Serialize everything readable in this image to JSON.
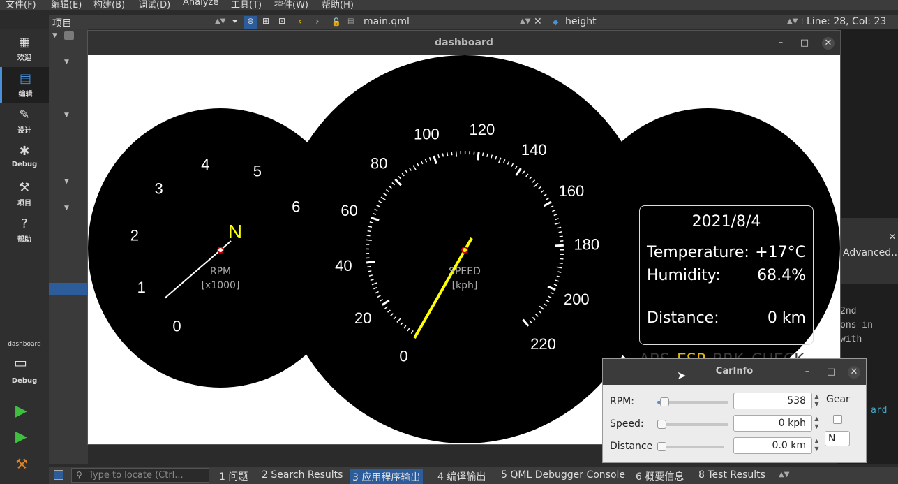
{
  "menu": [
    "文件(F)",
    "编辑(E)",
    "构建(B)",
    "调试(D)",
    "Analyze",
    "工具(T)",
    "控件(W)",
    "帮助(H)"
  ],
  "modes": [
    {
      "label": "欢迎",
      "icon": "grid-icon"
    },
    {
      "label": "编辑",
      "icon": "edit-doc-icon"
    },
    {
      "label": "设计",
      "icon": "pencil-icon"
    },
    {
      "label": "Debug",
      "icon": "bug-icon"
    },
    {
      "label": "项目",
      "icon": "wrench-icon"
    },
    {
      "label": "帮助",
      "icon": "help-icon"
    }
  ],
  "kit": {
    "project": "dashboard",
    "mode": "Debug"
  },
  "toolbar": {
    "project_label": "项目",
    "file": "main.qml",
    "symbol": "height",
    "position": "Line: 28, Col: 23"
  },
  "right_code": [
    "Advanced...",
    "2nd",
    "ons in",
    " with",
    "ard"
  ],
  "dashboard": {
    "title": "dashboard",
    "rpm_gauge": {
      "ticks": [
        "0",
        "1",
        "2",
        "3",
        "4",
        "5",
        "6"
      ],
      "label": "RPM",
      "unit": "[x1000]",
      "gear": "N"
    },
    "speed_gauge": {
      "ticks": [
        "0",
        "20",
        "40",
        "60",
        "80",
        "100",
        "120",
        "140",
        "160",
        "180",
        "200",
        "220"
      ],
      "label": "SPEED",
      "unit": "[kph]"
    },
    "info": {
      "date": "2021/8/4",
      "temperature_label": "Temperature:",
      "temperature_value": "+17°C",
      "humidity_label": "Humidity:",
      "humidity_value": "68.4%",
      "distance_label": "Distance:",
      "distance_value": "0 km"
    },
    "warnings": [
      {
        "label": "ABS",
        "active": false
      },
      {
        "label": "ESP",
        "active": true
      },
      {
        "label": "BRK",
        "active": false
      },
      {
        "label": "CHECK",
        "active": false
      }
    ],
    "colors": {
      "gauge": "#000000",
      "needle_speed": "#ffff00",
      "needle_rpm": "#ffffff",
      "gear": "#ffff00",
      "warning_on": "#e6b800"
    }
  },
  "carinfo": {
    "title": "CarInfo",
    "rpm_label": "RPM:",
    "rpm_value": "538",
    "rpm_level": 0.05,
    "speed_label": "Speed:",
    "speed_value": "0 kph",
    "speed_level": 0,
    "distance_label": "Distance",
    "distance_value": "0.0 km",
    "distance_level": 0,
    "gear_label": "Gear",
    "gear_value": "N"
  },
  "bottombar": {
    "locate_placeholder": "Type to locate (Ctrl...",
    "tabs": [
      "1 问题",
      "2 Search Results",
      "3 应用程序输出",
      "4 编译输出",
      "5 QML Debugger Console",
      "6 概要信息",
      "8 Test Results"
    ]
  }
}
